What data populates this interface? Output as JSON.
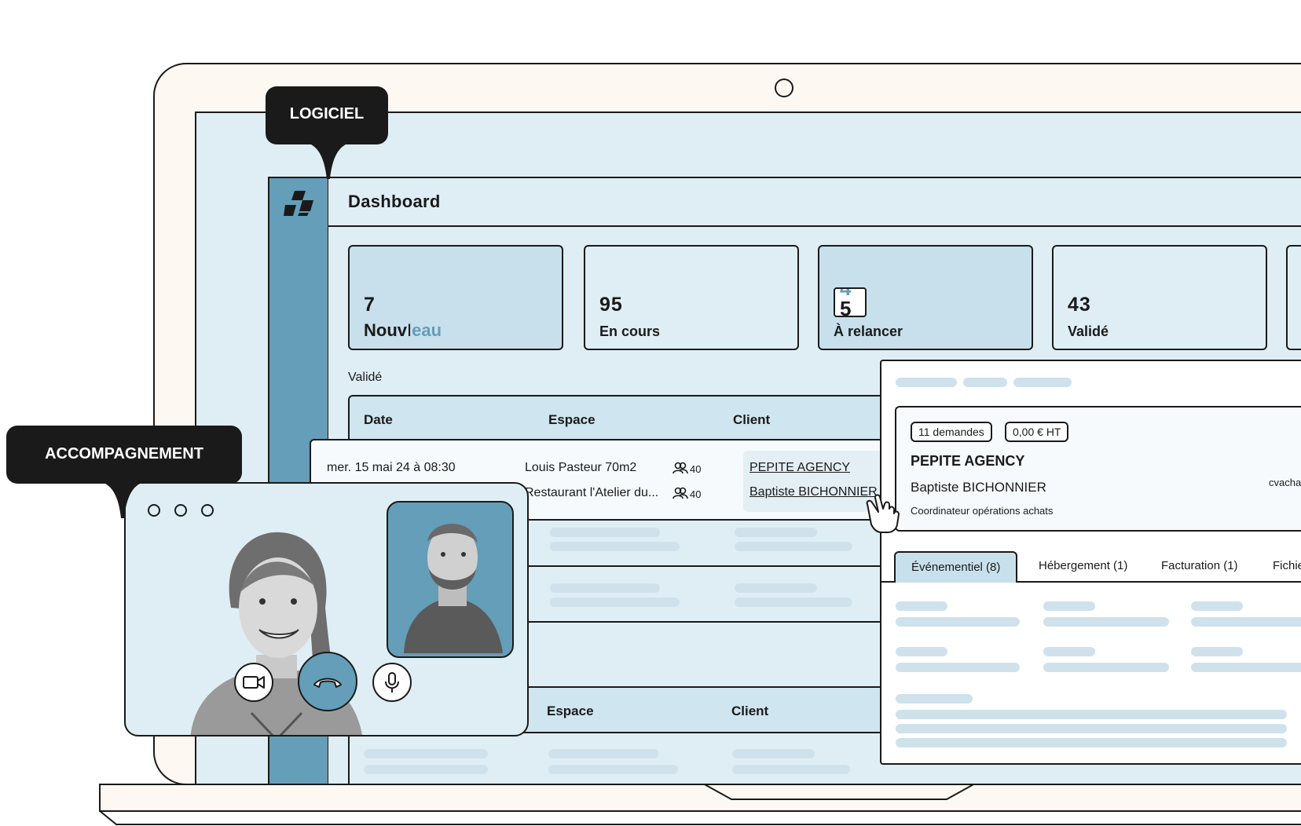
{
  "tags": {
    "software": "LOGICIEL",
    "support": "ACCOMPAGNEMENT"
  },
  "header": {
    "title": "Dashboard"
  },
  "stats": [
    {
      "value": "7",
      "label_typed": "Nouv",
      "label_rest": "eau"
    },
    {
      "value": "95",
      "label": "En cours"
    },
    {
      "value_old": "4",
      "value": "5",
      "label": "À relancer"
    },
    {
      "value": "43",
      "label": "Validé"
    }
  ],
  "section_label": "Validé",
  "table": {
    "columns": [
      "Date",
      "Espace",
      "Client"
    ],
    "rows": [
      {
        "date": "mer. 15 mai 24 à 08:30",
        "space": "Louis Pasteur 70m2",
        "capacity": "40",
        "client": "PEPITE AGENCY"
      },
      {
        "date": "",
        "space": "Restaurant l'Atelier du...",
        "capacity": "40",
        "client": "Baptiste BICHONNIER"
      }
    ]
  },
  "table2": {
    "columns": [
      "Espace",
      "Client"
    ]
  },
  "panel": {
    "badges": [
      "11 demandes",
      "0,00 € HT"
    ],
    "company": "PEPITE AGENCY",
    "contact": "Baptiste BICHONNIER",
    "role": "Coordinateur opérations achats",
    "email_partial": "cvacha",
    "tabs": [
      "Événementiel (8)",
      "Hébergement (1)",
      "Facturation (1)",
      "Fichie"
    ]
  },
  "colors": {
    "accent": "#649eb8",
    "light": "#dfeef5",
    "ink": "#1a1a1a"
  }
}
